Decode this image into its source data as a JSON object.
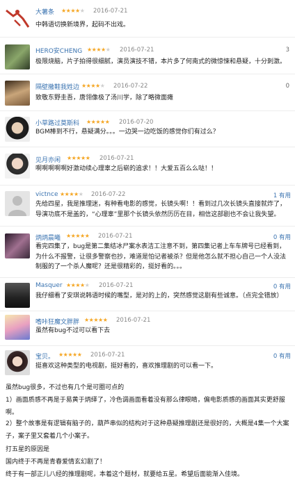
{
  "reviews": [
    {
      "username": "大薯条",
      "rating": 4,
      "date": "2016-07-21",
      "count": "",
      "text": "中韩语切换新境界，起码不出戏。"
    },
    {
      "username": "HERO安CHENG",
      "rating": 4,
      "date": "2016-07-21",
      "count": "3",
      "text": "极限烧脑，片子拍得很细腻，演员演技不错，本片多了何南式的微惊悚和悬疑，十分刺激。"
    },
    {
      "username": "隔壁撒鞋我姓边",
      "rating": 4,
      "date": "2016-07-22",
      "count": "0",
      "text": "致敬东野圭吾，唐翎像极了汤川学，除了略微面瘫"
    },
    {
      "username": "小草路过莫斯科",
      "rating": 5,
      "date": "2016-07-20",
      "count": "",
      "text": "BGM棒到不行，悬疑满分。。。一边哭一边吃饭的感觉你们有过么？"
    },
    {
      "username": "见月亦闲",
      "rating": 5,
      "date": "2016-07-21",
      "count": "",
      "text": "啊啊啊啊啊好激动续心理辜之后崭的追求！！大爱五百么么哒！！"
    },
    {
      "username": "victnce",
      "rating": 4,
      "date": "2016-07-22",
      "count": "1 有用",
      "text": "先给四星，我是推理迷，有种看电影的感觉，长镜头啊！！看到过几次长镜头直接就炸了，导演功底不是盖的，“心理辜”里那个长镜头依然历历在目，相信这部剧也不会让我失望。"
    },
    {
      "username": "炳炳晨曦",
      "rating": 5,
      "date": "2016-07-21",
      "count": "0 有用",
      "text": "看完四集了，bug是第二集结冰尸案水表洁工注意不到，第四集记者上车车牌号已经看到，为什么不报警，让很多警察也抄，难道是怕记者被杀？但是他怎么就不担心自己一个人没法制服的了一个杀人魔呢？还是很精彩的，挺好看的。。。"
    },
    {
      "username": "Masquer",
      "rating": 4,
      "date": "2016-07-21",
      "count": "0 有用",
      "text": "我仔细看了安琪说韩语时候的嘴型，是对的上的，突然感觉这剧有些诚意。（点完全错放）"
    },
    {
      "username": "嗜咔狂魔文胖胖",
      "rating": 5,
      "date": "2016-07-21",
      "count": "",
      "text": "虽然有bug不过可以看下去"
    },
    {
      "username": "宝贝。",
      "rating": 5,
      "date": "2016-07-21",
      "count": "0 有用",
      "text": "挺喜欢这种类型的电视剧，挺好看的，喜欢推理剧的可以看一下。"
    }
  ],
  "summary": [
    "虽然bug很多，不过也有几个是可圈可点的",
    "1）画面质感不再是于易黄于炳绎了，冷色调画面看着没有那么律眼睛，偏电影质感的画面其实更舒服啊。",
    "2）整个故事是有逻辑有脑子的，葫芦串似的结构对于这种悬疑推理剧还是很好的，大概是4集一个大案子，案子里又套着几个小案子。",
    "打五星的原因是",
    "国内终于不再是青春爱情玄幻剧了！",
    "终于有一部正儿八经的推理剧呢，本着这个题材，就要给五星。希望后面能渐入佳境。"
  ],
  "colors": {
    "accent": "#3a73b0",
    "star": "#f5a623",
    "star_off": "#cfcfcf"
  }
}
